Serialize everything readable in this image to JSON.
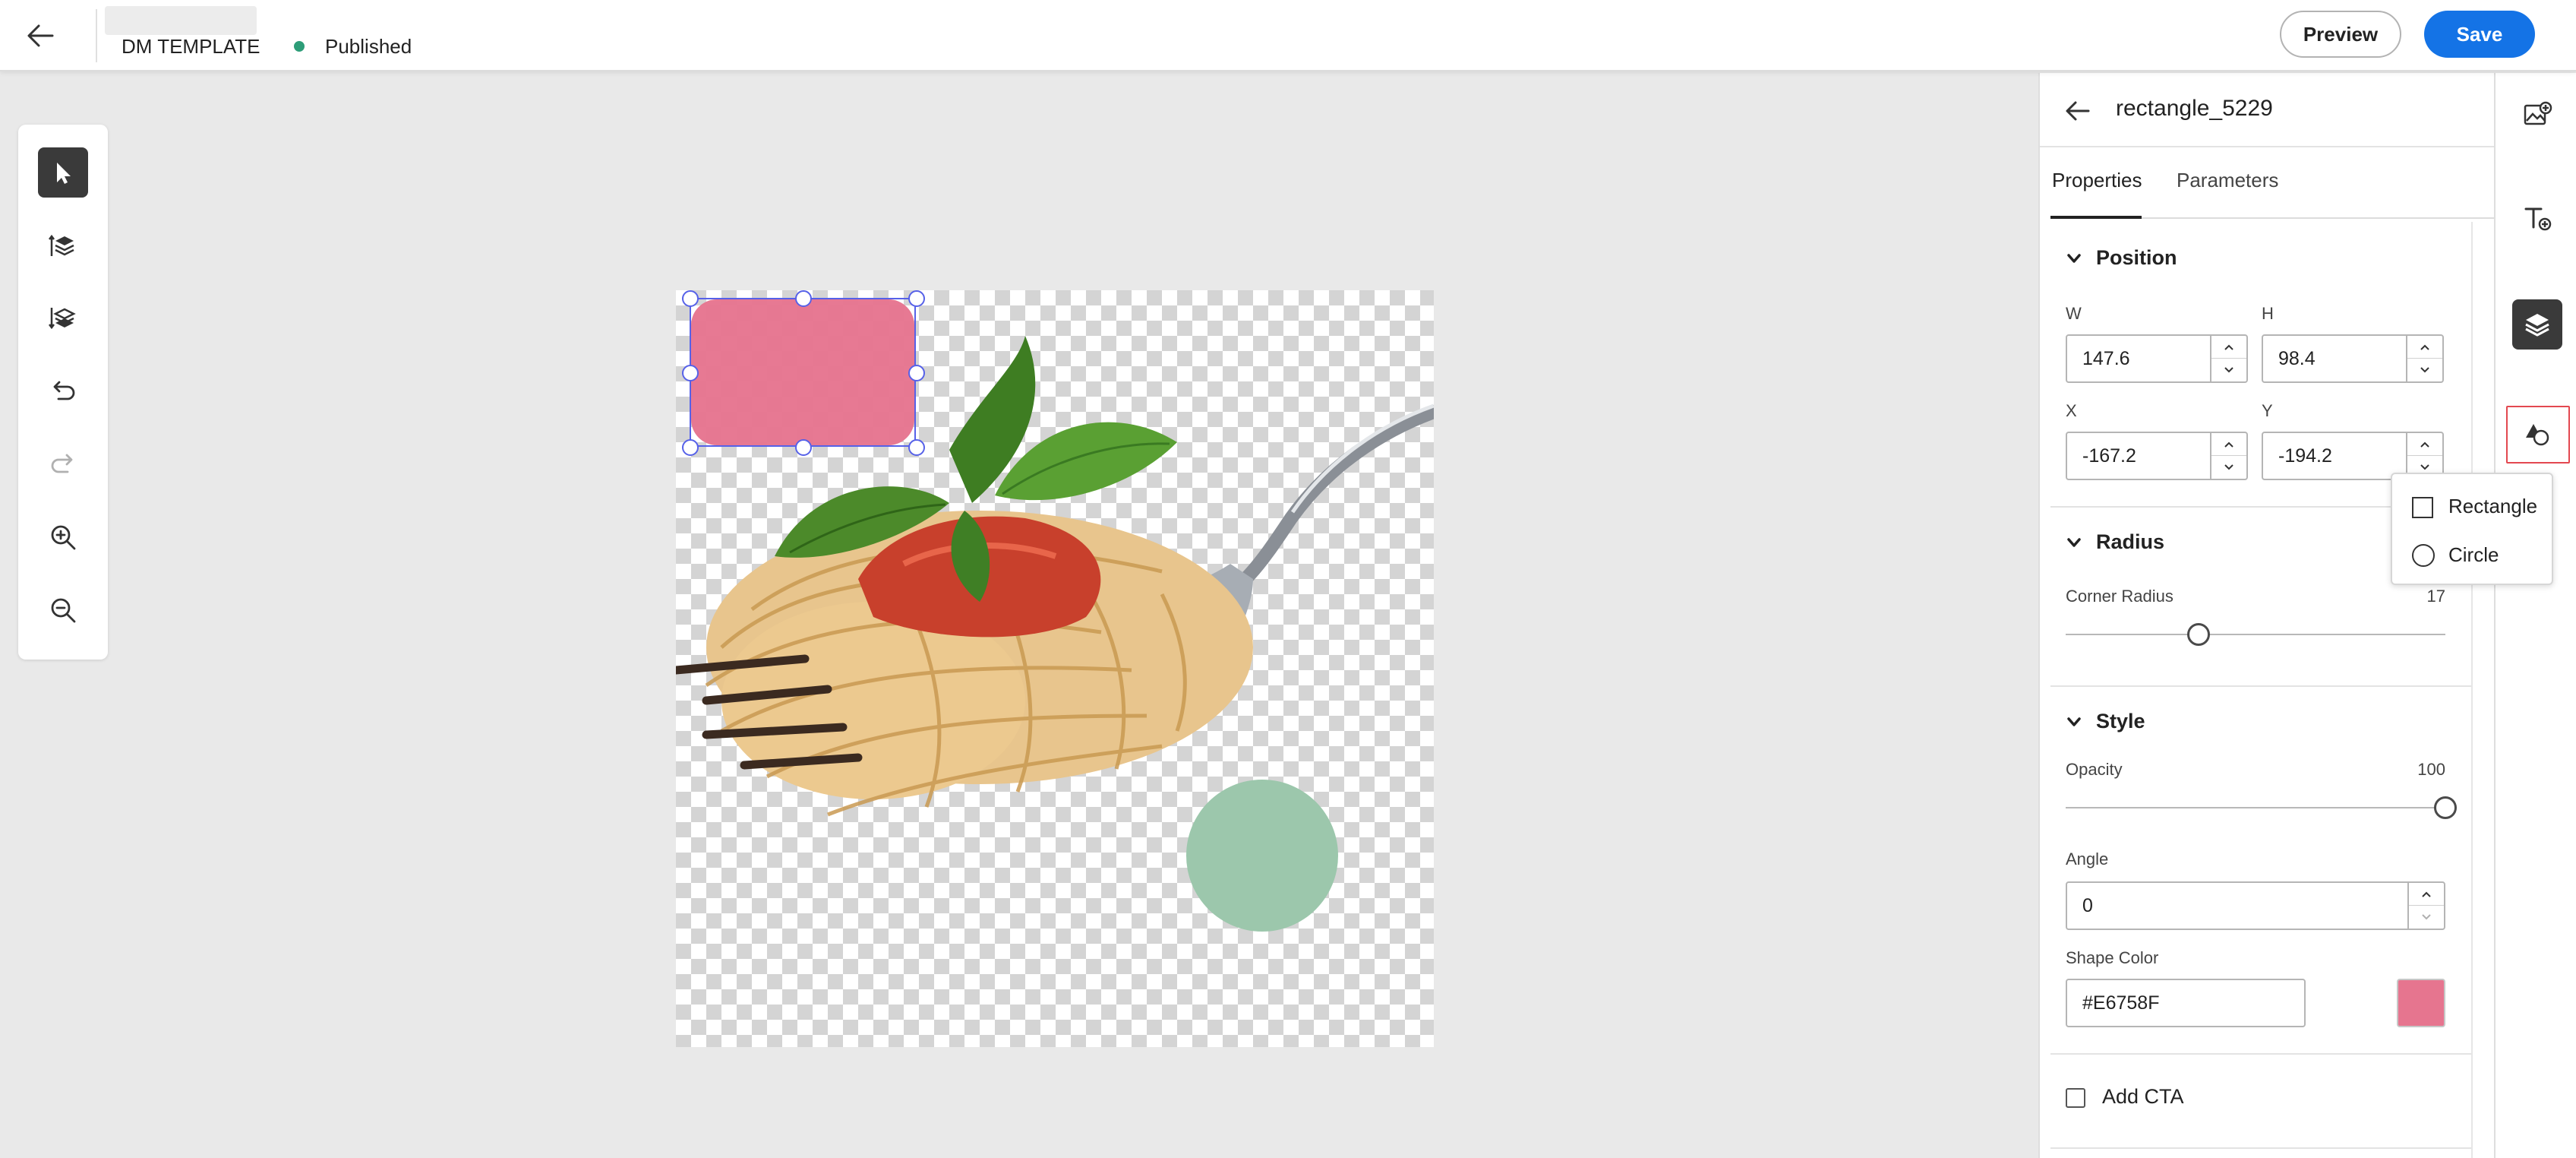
{
  "header": {
    "template_name": "DM TEMPLATE",
    "status": "Published",
    "status_color": "#2d9d78",
    "preview_label": "Preview",
    "save_label": "Save",
    "accent_color": "#1473e6"
  },
  "toolbar": {
    "tools": [
      "select-tool",
      "bring-forward-icon",
      "send-backward-icon",
      "undo-icon",
      "redo-icon",
      "zoom-in-icon",
      "zoom-out-icon"
    ]
  },
  "canvas": {
    "selected_shape_color": "#E6758F",
    "circle_color": "#9cc7ac"
  },
  "panel": {
    "element_name": "rectangle_5229",
    "tabs": [
      "Properties",
      "Parameters"
    ],
    "active_tab": "Properties",
    "position": {
      "title": "Position",
      "w_label": "W",
      "w_value": "147.6",
      "h_label": "H",
      "h_value": "98.4",
      "x_label": "X",
      "x_value": "-167.2",
      "y_label": "Y",
      "y_value": "-194.2"
    },
    "radius": {
      "title": "Radius",
      "corner_label": "Corner Radius",
      "corner_value": "17",
      "corner_fraction": 0.35
    },
    "style": {
      "title": "Style",
      "opacity_label": "Opacity",
      "opacity_value": "100",
      "opacity_fraction": 1.0,
      "angle_label": "Angle",
      "angle_value": "0",
      "shape_color_label": "Shape Color",
      "shape_color_value": "#E6758F"
    },
    "cta_label": "Add CTA"
  },
  "rail": {
    "buttons": [
      "add-image-icon",
      "add-text-icon",
      "layers-icon",
      "shapes-icon"
    ]
  },
  "shape_menu": {
    "items": [
      {
        "label": "Rectangle",
        "icon": "square-icon"
      },
      {
        "label": "Circle",
        "icon": "circle-icon"
      }
    ]
  }
}
